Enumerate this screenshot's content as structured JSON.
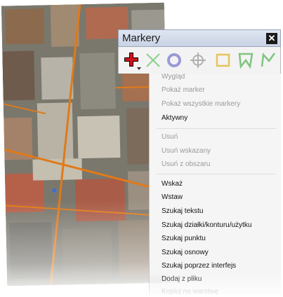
{
  "window": {
    "title": "Markery",
    "close_glyph": "✕"
  },
  "toolbar": {
    "tools": [
      {
        "name": "add-marker-icon",
        "color": "#d0121b"
      },
      {
        "name": "delete-cross-icon",
        "color": "#8fcf8f"
      },
      {
        "name": "circle-marker-icon",
        "color": "#9a9ad6"
      },
      {
        "name": "crosshair-target-icon",
        "color": "#b0b0b0"
      },
      {
        "name": "rectangle-icon",
        "color": "#e6c35c"
      },
      {
        "name": "polygon-icon",
        "color": "#7fc47f"
      },
      {
        "name": "polyline-icon",
        "color": "#7fc47f"
      }
    ]
  },
  "menu": {
    "view_header": "Wygląd",
    "show_marker": "Pokaż marker",
    "show_all_markers": "Pokaż wszystkie markery",
    "active": "Aktywny",
    "delete": "Usuń",
    "delete_selected": "Usuń wskazany",
    "delete_from_area": "Usuń z obszaru",
    "point": "Wskaż",
    "insert": "Wstaw",
    "search_text": "Szukaj tekstu",
    "search_parcel": "Szukaj działki/konturu/użytku",
    "search_point": "Szukaj punktu",
    "search_base": "Szukaj osnowy",
    "search_interface": "Szukaj poprzez interfejs",
    "add_from_file": "Dodaj z pliku",
    "copy_to_layer": "Kopiuj na warstwę"
  }
}
